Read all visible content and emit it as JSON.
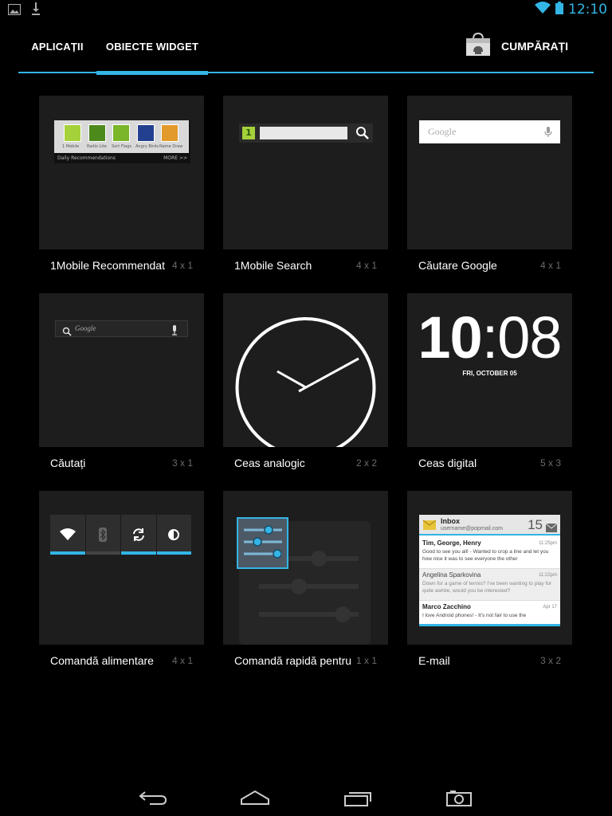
{
  "status_bar": {
    "time": "12:10",
    "left_icons": [
      "gallery-notification-icon",
      "download-notification-icon"
    ],
    "right_icons": [
      "wifi-icon",
      "battery-icon"
    ]
  },
  "tabs": {
    "apps_label": "APLICAȚII",
    "widgets_label": "OBIECTE WIDGET",
    "active": "widgets"
  },
  "shop": {
    "label": "CUMPĂRAȚI",
    "icon": "shopping-bag-icon"
  },
  "accent_color": "#33b5e5",
  "widgets": [
    {
      "name": "1Mobile Recommendat",
      "size": "4 x 1",
      "preview": {
        "apps": [
          "1 Mobile",
          "Radio Lite",
          "Sort Flags",
          "Angry Birds",
          "Name Draw"
        ],
        "footer": "Daily Recommendations",
        "more": "MORE >>"
      }
    },
    {
      "name": "1Mobile Search",
      "size": "4 x 1",
      "preview": {
        "badge": "1"
      }
    },
    {
      "name": "Căutare Google",
      "size": "4 x 1",
      "preview": {
        "hint": "Google"
      }
    },
    {
      "name": "Căutați",
      "size": "3 x 1",
      "preview": {
        "hint": "Google"
      }
    },
    {
      "name": "Ceas analogic",
      "size": "2 x 2"
    },
    {
      "name": "Ceas digital",
      "size": "5 x 3",
      "preview": {
        "hours": "10",
        "separator": ":",
        "minutes": "08",
        "date": "FRI, OCTOBER 05"
      }
    },
    {
      "name": "Comandă alimentare",
      "size": "4 x 1"
    },
    {
      "name": "Comandă rapidă pentru",
      "size": "1 x 1"
    },
    {
      "name": "E-mail",
      "size": "3 x 2",
      "preview": {
        "title": "Inbox",
        "account": "username@popmail.com",
        "unread_count": "15",
        "messages": [
          {
            "from": "Tim, George, Henry",
            "time": "11:25pm",
            "body": "Good to see you all! - Wanted to crop a line and let you how nice it was to see everyone the other"
          },
          {
            "from": "Angelina Sparkovina",
            "time": "11:22pm",
            "body": "Down for a game of tennis? I've been wanting to play for quite awhile, would you be interested?"
          },
          {
            "from": "Marco Zacchino",
            "time": "Apr 17",
            "body": "I love Android phones! - It's not fair to use the"
          }
        ]
      }
    }
  ],
  "nav": {
    "back_icon": "back-icon",
    "home_icon": "home-icon",
    "recents_icon": "recent-apps-icon",
    "screenshot_icon": "camera-icon"
  }
}
